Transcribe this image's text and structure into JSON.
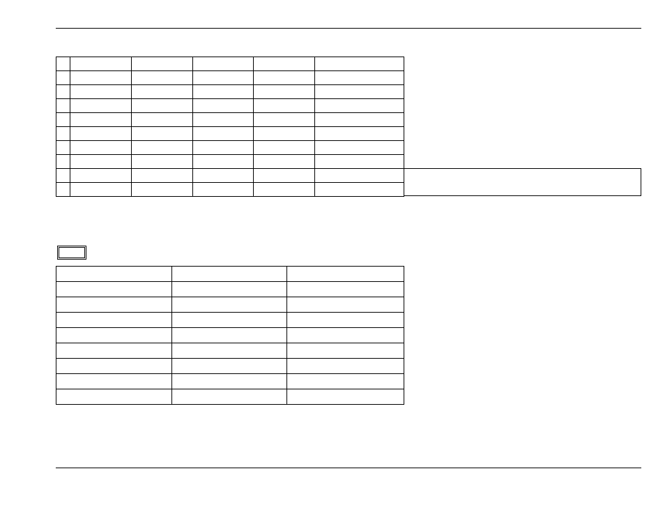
{
  "table1": {
    "rows": [
      {
        "c0": "",
        "c1": "",
        "c2": "",
        "c3": "",
        "c4": "",
        "c5": ""
      },
      {
        "c0": "",
        "c1": "",
        "c2": "",
        "c3": "",
        "c4": "",
        "c5": ""
      },
      {
        "c0": "",
        "c1": "",
        "c2": "",
        "c3": "",
        "c4": "",
        "c5": ""
      },
      {
        "c0": "",
        "c1": "",
        "c2": "",
        "c3": "",
        "c4": "",
        "c5": ""
      },
      {
        "c0": "",
        "c1": "",
        "c2": "",
        "c3": "",
        "c4": "",
        "c5": ""
      },
      {
        "c0": "",
        "c1": "",
        "c2": "",
        "c3": "",
        "c4": "",
        "c5": ""
      },
      {
        "c0": "",
        "c1": "",
        "c2": "",
        "c3": "",
        "c4": "",
        "c5": ""
      },
      {
        "c0": "",
        "c1": "",
        "c2": "",
        "c3": "",
        "c4": "",
        "c5": ""
      },
      {
        "c0": "",
        "c1": "",
        "c2": "",
        "c3": "",
        "c4": "",
        "c5": ""
      },
      {
        "c0": "",
        "c1": "",
        "c2": "",
        "c3": "",
        "c4": "",
        "c5": ""
      }
    ],
    "sidebox": ""
  },
  "button_label": "",
  "table2": {
    "rows": [
      {
        "d0": "",
        "d1": "",
        "d2": ""
      },
      {
        "d0": "",
        "d1": "",
        "d2": ""
      },
      {
        "d0": "",
        "d1": "",
        "d2": ""
      },
      {
        "d0": "",
        "d1": "",
        "d2": ""
      },
      {
        "d0": "",
        "d1": "",
        "d2": ""
      },
      {
        "d0": "",
        "d1": "",
        "d2": ""
      },
      {
        "d0": "",
        "d1": "",
        "d2": ""
      },
      {
        "d0": "",
        "d1": "",
        "d2": ""
      },
      {
        "d0": "",
        "d1": "",
        "d2": ""
      }
    ]
  }
}
